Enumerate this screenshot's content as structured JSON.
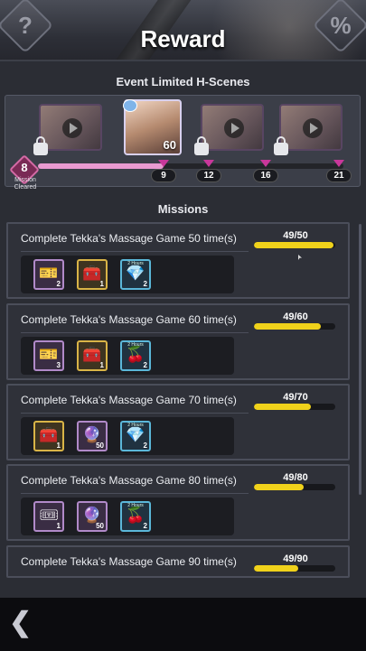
{
  "header": {
    "title": "Reward",
    "help_icon": "?",
    "rate_icon": "%"
  },
  "scenes": {
    "title": "Event Limited H-Scenes",
    "active_count": "60",
    "mission_count": "8",
    "mission_label": "Mission Cleared",
    "progress_fraction": 0.41,
    "markers": [
      "9",
      "12",
      "16",
      "21"
    ]
  },
  "missions": {
    "title": "Missions",
    "items": [
      {
        "title": "Complete Tekka's Massage Game 50 time(s)",
        "progress": "49/50",
        "fraction": 0.98,
        "rewards": [
          {
            "icon": "ticket-icon",
            "glyph": "🎫",
            "qty": "2",
            "hours": ""
          },
          {
            "icon": "chest-icon",
            "glyph": "🧰",
            "qty": "1",
            "hours": ""
          },
          {
            "icon": "boost-icon",
            "glyph": "💎",
            "qty": "2",
            "hours": "2 Hours"
          }
        ]
      },
      {
        "title": "Complete Tekka's Massage Game 60 time(s)",
        "progress": "49/60",
        "fraction": 0.82,
        "rewards": [
          {
            "icon": "ticket-icon",
            "glyph": "🎫",
            "qty": "3",
            "hours": ""
          },
          {
            "icon": "chest-icon",
            "glyph": "🧰",
            "qty": "1",
            "hours": ""
          },
          {
            "icon": "boost-icon",
            "glyph": "🍒",
            "qty": "2",
            "hours": "2 Hours"
          }
        ]
      },
      {
        "title": "Complete Tekka's Massage Game 70 time(s)",
        "progress": "49/70",
        "fraction": 0.7,
        "rewards": [
          {
            "icon": "chest-icon",
            "glyph": "🧰",
            "qty": "1",
            "hours": ""
          },
          {
            "icon": "orb-icon",
            "glyph": "🔮",
            "qty": "50",
            "hours": ""
          },
          {
            "icon": "boost-icon",
            "glyph": "💎",
            "qty": "2",
            "hours": "2 Hours"
          }
        ]
      },
      {
        "title": "Complete Tekka's Massage Game 80 time(s)",
        "progress": "49/80",
        "fraction": 0.61,
        "rewards": [
          {
            "icon": "ticket-icon",
            "glyph": "🎟",
            "qty": "1",
            "hours": ""
          },
          {
            "icon": "orb-icon",
            "glyph": "🔮",
            "qty": "50",
            "hours": ""
          },
          {
            "icon": "boost-icon",
            "glyph": "🍒",
            "qty": "2",
            "hours": "2 Hours"
          }
        ]
      },
      {
        "title": "Complete Tekka's Massage Game 90 time(s)",
        "progress": "49/90",
        "fraction": 0.54,
        "rewards": []
      }
    ]
  },
  "footer": {
    "back_icon": "❮"
  }
}
